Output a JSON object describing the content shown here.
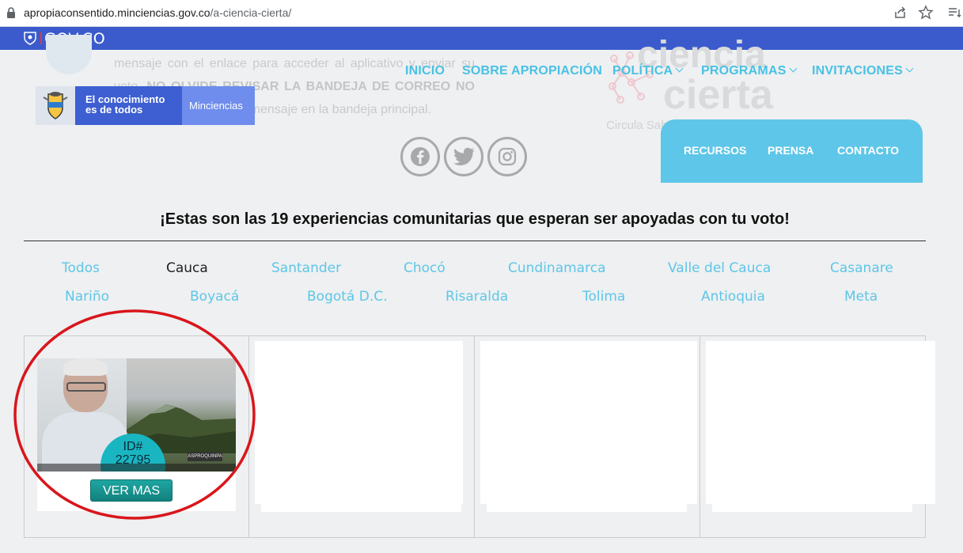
{
  "browser": {
    "url_host": "apropiaconsentido.minciencias.gov.co",
    "url_path": "/a-ciencia-cierta/"
  },
  "gov_bar": {
    "text": "GOV.CO"
  },
  "background": {
    "paragraph_parts": [
      "mensaje con el enlace para acceder al aplicativo y enviar su voto.",
      "NO OLVIDE REVISAR LA BANDEJA DE CORREO NO",
      "caso de no encontrar el mensaje en la bandeja principal."
    ],
    "ciencia": "ciencia",
    "cierta": "cierta",
    "circula": "Circula Sab"
  },
  "logo": {
    "tagline_line1": "El conocimiento",
    "tagline_line2": "es de todos",
    "brand": "Minciencias"
  },
  "nav": {
    "inicio": "INICIO",
    "sobre": "SOBRE APROPIACIÓN",
    "politica": "POLÍTICA",
    "programas": "PROGRAMAS",
    "invitaciones": "INVITACIONES",
    "recursos": "RECURSOS",
    "prensa": "PRENSA",
    "contacto": "CONTACTO"
  },
  "headline": "¡Estas son las 19 experiencias comunitarias que esperan ser apoyadas con tu voto!",
  "filters": {
    "row1": [
      "Todos",
      "Cauca",
      "Santander",
      "Chocó",
      "Cundinamarca",
      "Valle del Cauca",
      "Casanare"
    ],
    "row2": [
      "Nariño",
      "Boyacá",
      "Bogotá D.C.",
      "Risaralda",
      "Tolima",
      "Antioquia",
      "Meta"
    ],
    "active": "Cauca"
  },
  "card": {
    "id_label": "ID#",
    "id_number": "22795",
    "video_label": "ASPROQUINPA",
    "button": "VER MAS"
  },
  "colors": {
    "gov_blue": "#3b5bcd",
    "accent_cyan": "#5ec6e8",
    "button_teal": "#1fa6a2",
    "annotation_red": "#d9161c"
  }
}
